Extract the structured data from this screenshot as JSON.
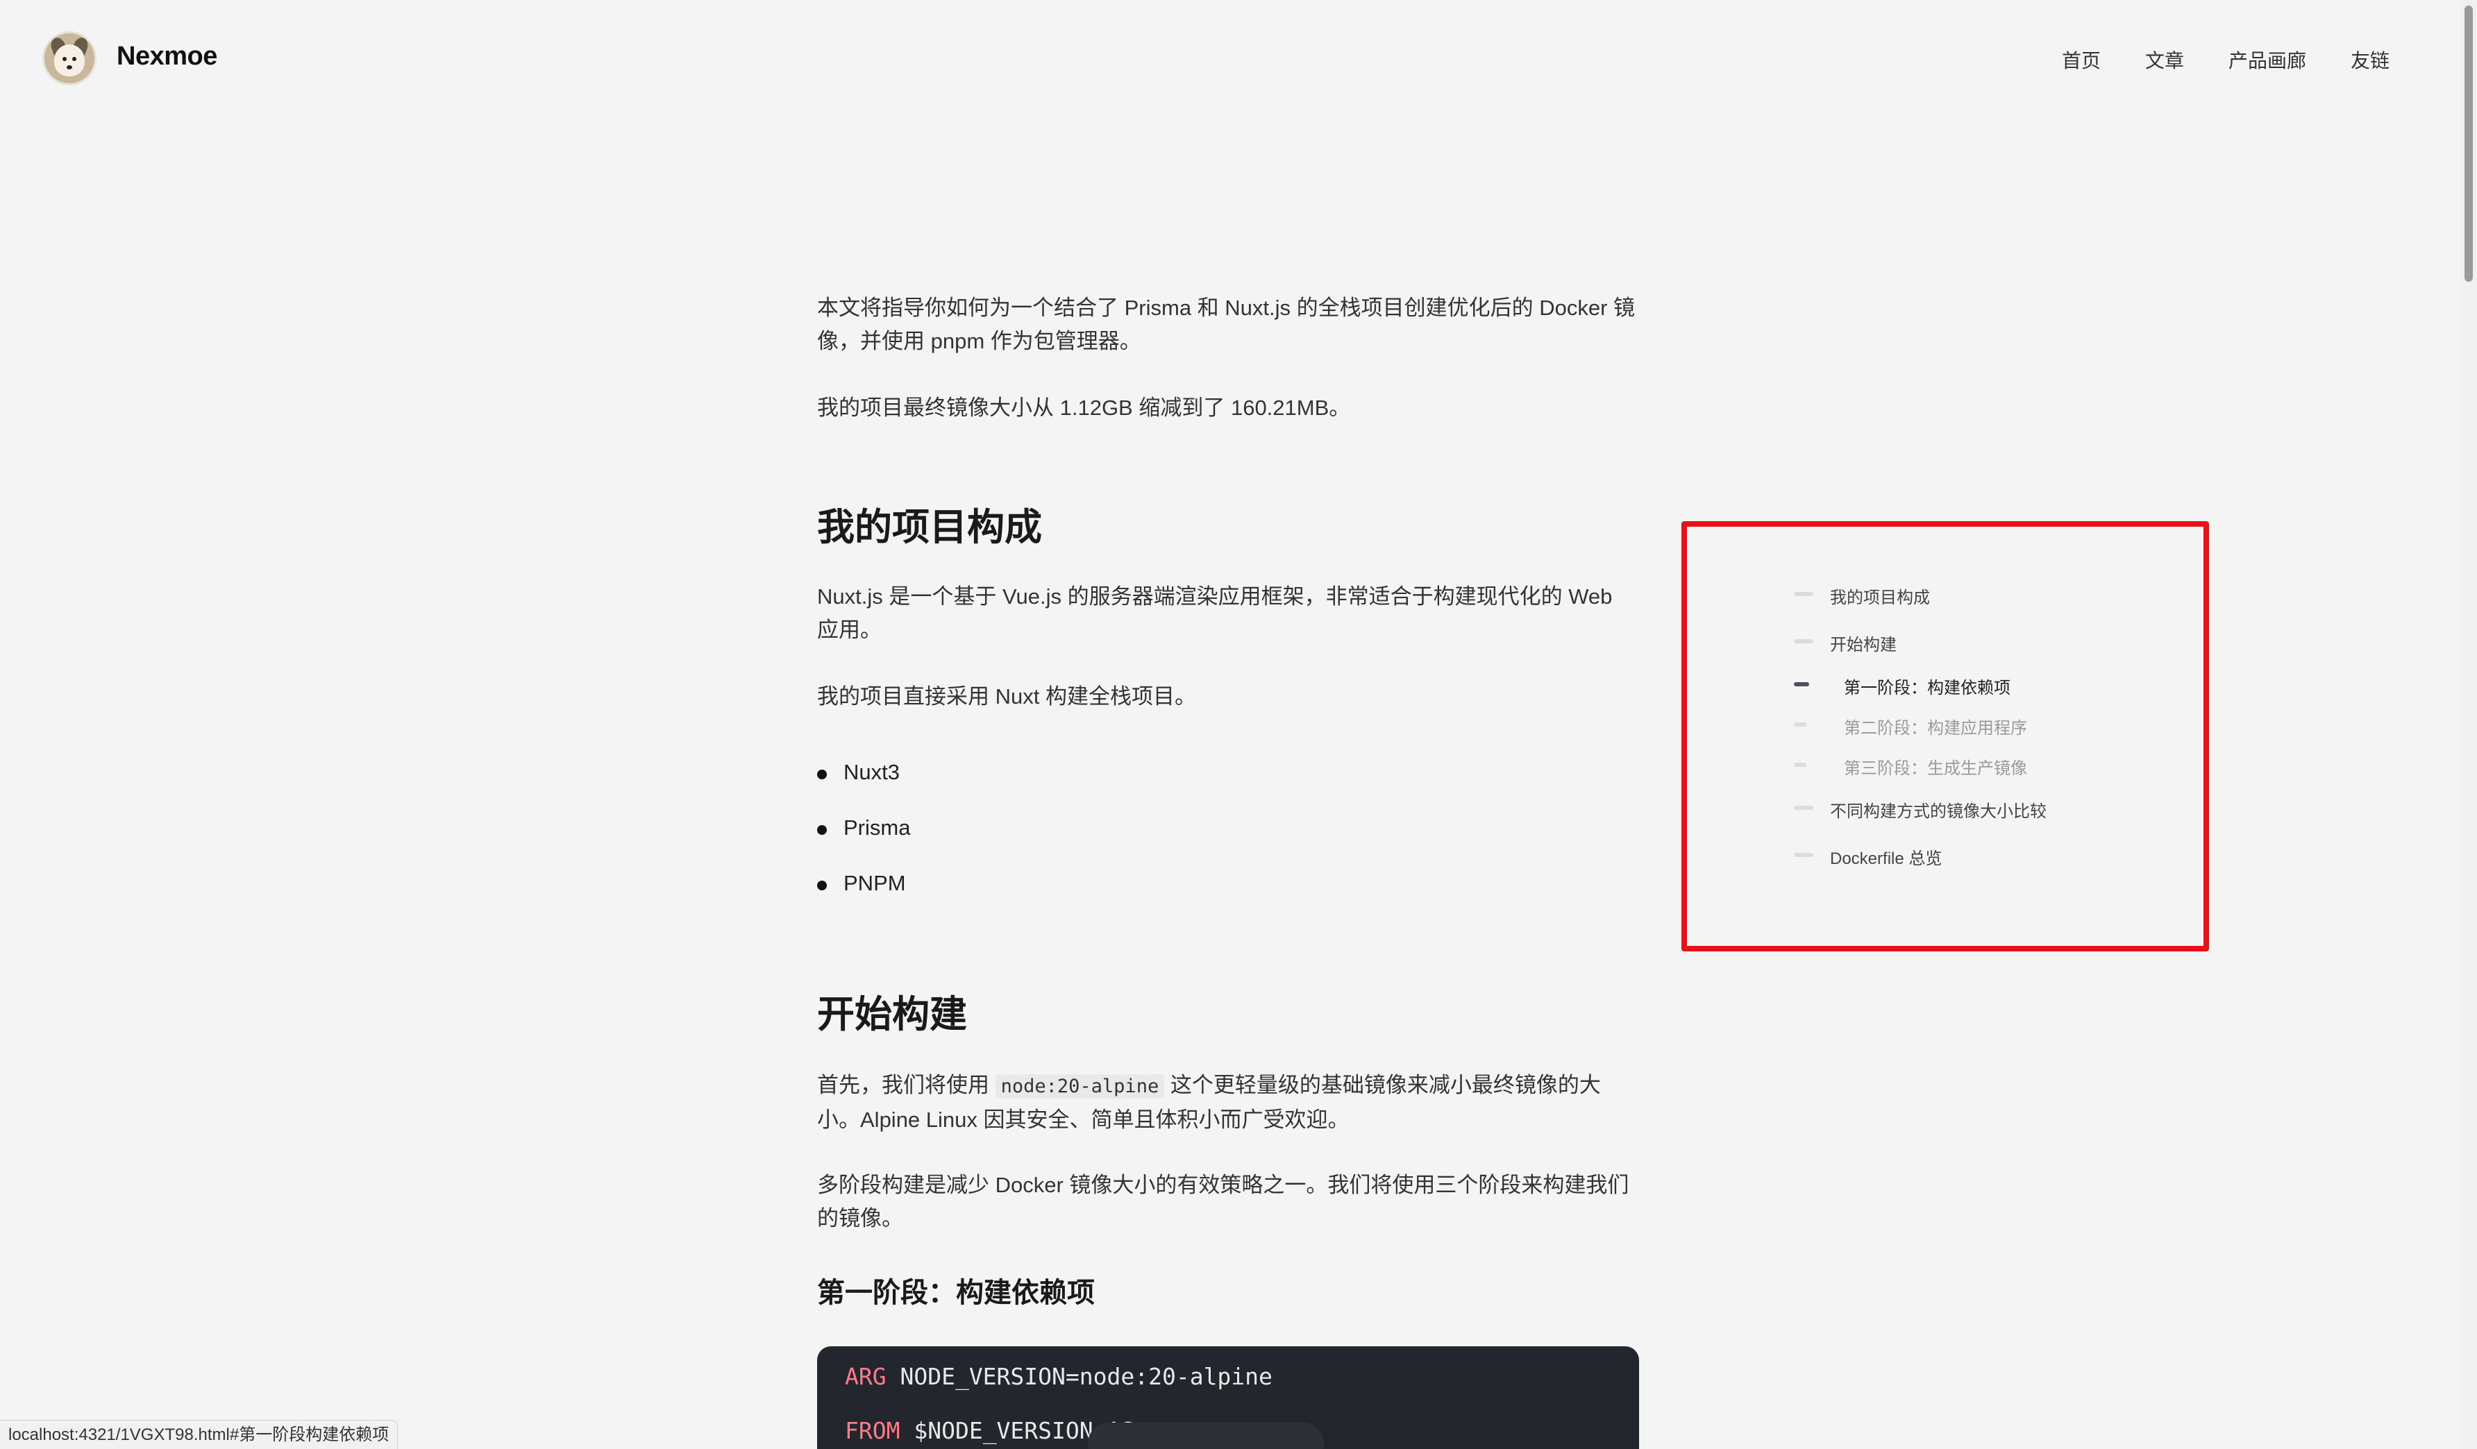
{
  "header": {
    "brand": "Nexmoe",
    "nav": [
      "首页",
      "文章",
      "产品画廊",
      "友链"
    ]
  },
  "article": {
    "intro_1": "本文将指导你如何为一个结合了 Prisma 和 Nuxt.js 的全栈项目创建优化后的 Docker 镜像，并使用 pnpm 作为包管理器。",
    "intro_2": "我的项目最终镜像大小从 1.12GB 缩减到了 160.21MB。",
    "section1_title": "我的项目构成",
    "section1_p1": "Nuxt.js 是一个基于 Vue.js 的服务器端渲染应用框架，非常适合于构建现代化的 Web 应用。",
    "section1_p2": "我的项目直接采用 Nuxt 构建全栈项目。",
    "list": [
      "Nuxt3",
      "Prisma",
      "PNPM"
    ],
    "section2_title": "开始构建",
    "section2_p1_before": "首先，我们将使用 ",
    "section2_p1_code": "node:20-alpine",
    "section2_p1_after": " 这个更轻量级的基础镜像来减小最终镜像的大小。Alpine Linux 因其安全、简单且体积小而广受欢迎。",
    "section2_p2": "多阶段构建是减少 Docker 镜像大小的有效策略之一。我们将使用三个阶段来构建我们的镜像。",
    "section3_title": "第一阶段：构建依赖项",
    "code": {
      "line1_kw": "ARG",
      "line1_rest": " NODE_VERSION=node:20-alpine",
      "line2_kw": "FROM",
      "line2_rest": " $NODE_VERSION AS"
    }
  },
  "toc": {
    "items": [
      {
        "label": "我的项目构成",
        "level": 1,
        "active": false
      },
      {
        "label": "开始构建",
        "level": 1,
        "active": false
      },
      {
        "label": "第一阶段：构建依赖项",
        "level": 2,
        "active": true
      },
      {
        "label": "第二阶段：构建应用程序",
        "level": 2,
        "active": false
      },
      {
        "label": "第三阶段：生成生产镜像",
        "level": 2,
        "active": false
      },
      {
        "label": "不同构建方式的镜像大小比较",
        "level": 1,
        "active": false
      },
      {
        "label": "Dockerfile 总览",
        "level": 1,
        "active": false
      }
    ]
  },
  "status": {
    "url": "localhost:4321/1VGXT98.html#第一阶段构建依赖项"
  },
  "colors": {
    "background": "#f4f4f4",
    "highlight_border": "#e8111a",
    "code_bg": "#24262d",
    "code_keyword": "#ff7b8a"
  }
}
